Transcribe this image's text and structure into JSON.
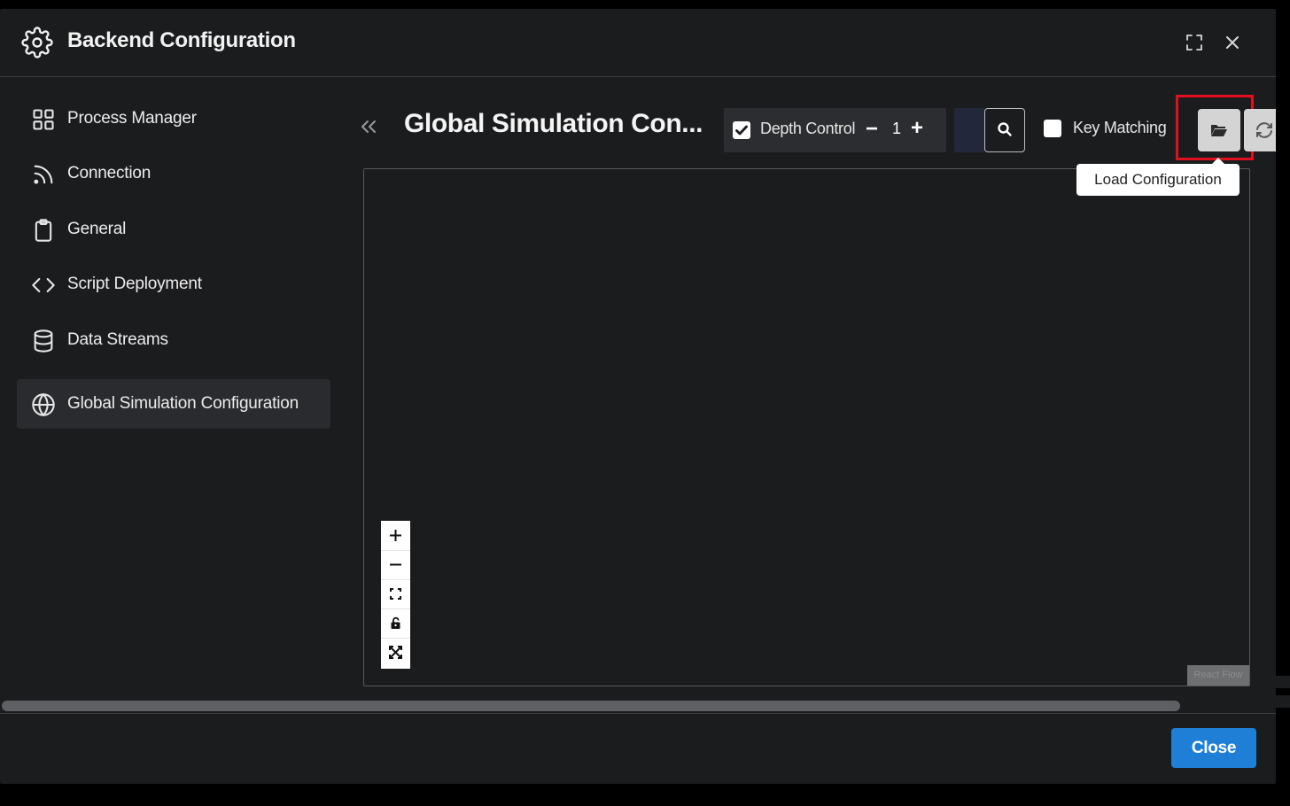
{
  "header": {
    "title": "Backend Configuration"
  },
  "sidebar": {
    "items": [
      {
        "label": "Process Manager",
        "icon": "grid-icon"
      },
      {
        "label": "Connection",
        "icon": "rss-icon"
      },
      {
        "label": "General",
        "icon": "clipboard-icon"
      },
      {
        "label": "Script Deployment",
        "icon": "code-icon"
      },
      {
        "label": "Data Streams",
        "icon": "database-icon"
      },
      {
        "label": "Global Simulation Configuration",
        "icon": "globe-icon",
        "active": true
      }
    ]
  },
  "main": {
    "title": "Global Simulation Con...",
    "depth_control": {
      "label": "Depth Control",
      "checked": true,
      "value": "1",
      "minus": "−",
      "plus": "+"
    },
    "key_matching": {
      "label": "Key Matching",
      "checked": false
    },
    "tooltip": "Load Configuration",
    "attribution": "React Flow"
  },
  "footer": {
    "close_label": "Close"
  },
  "colors": {
    "accent": "#1f7fd6",
    "highlight": "#e0101e",
    "background": "#1b1c1e"
  }
}
